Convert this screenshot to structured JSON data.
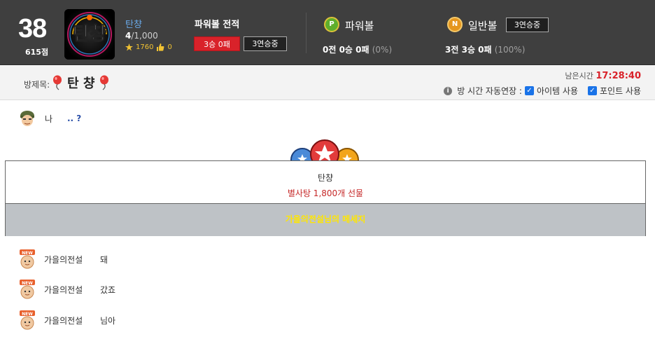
{
  "header": {
    "level": "38",
    "level_points": "615점",
    "nickname": "탄챵",
    "count_current": "4",
    "count_total": "/1,000",
    "stars": "1760",
    "likes": "0",
    "record_title": "파워볼 전적",
    "record_badge": "3승 0패",
    "record_streak": "3연승중",
    "powerball": {
      "coin": "P",
      "label": "파워볼",
      "record": "0전 0승 0패",
      "pct": "(0%)"
    },
    "normalball": {
      "coin": "N",
      "label": "일반볼",
      "streak": "3연승중",
      "record": "3전 3승 0패",
      "pct": "(100%)"
    }
  },
  "titlebar": {
    "room_label": "방제목:",
    "room_title": "탄 챵",
    "remain_label": "남은시간",
    "remain_time": "17:28:40",
    "auto_extend": "방 시간 자동연장 :",
    "item_use": "아이템 사용",
    "point_use": "포인트 사용"
  },
  "messages": [
    {
      "name": "나",
      "text": ".. ?"
    },
    {
      "name": "가을의전설",
      "text": "돼"
    },
    {
      "name": "가을의전설",
      "text": "갔죠"
    },
    {
      "name": "가을의전설",
      "text": "님아"
    }
  ],
  "gift": {
    "sender": "탄챵",
    "value": "별사탕 1,800개 선물",
    "message_line": "가을의전설님의 메세지"
  },
  "colors": {
    "accent_red": "#d9222a",
    "header_bg": "#3f3f3f",
    "gift_yellow": "#ffe600"
  }
}
